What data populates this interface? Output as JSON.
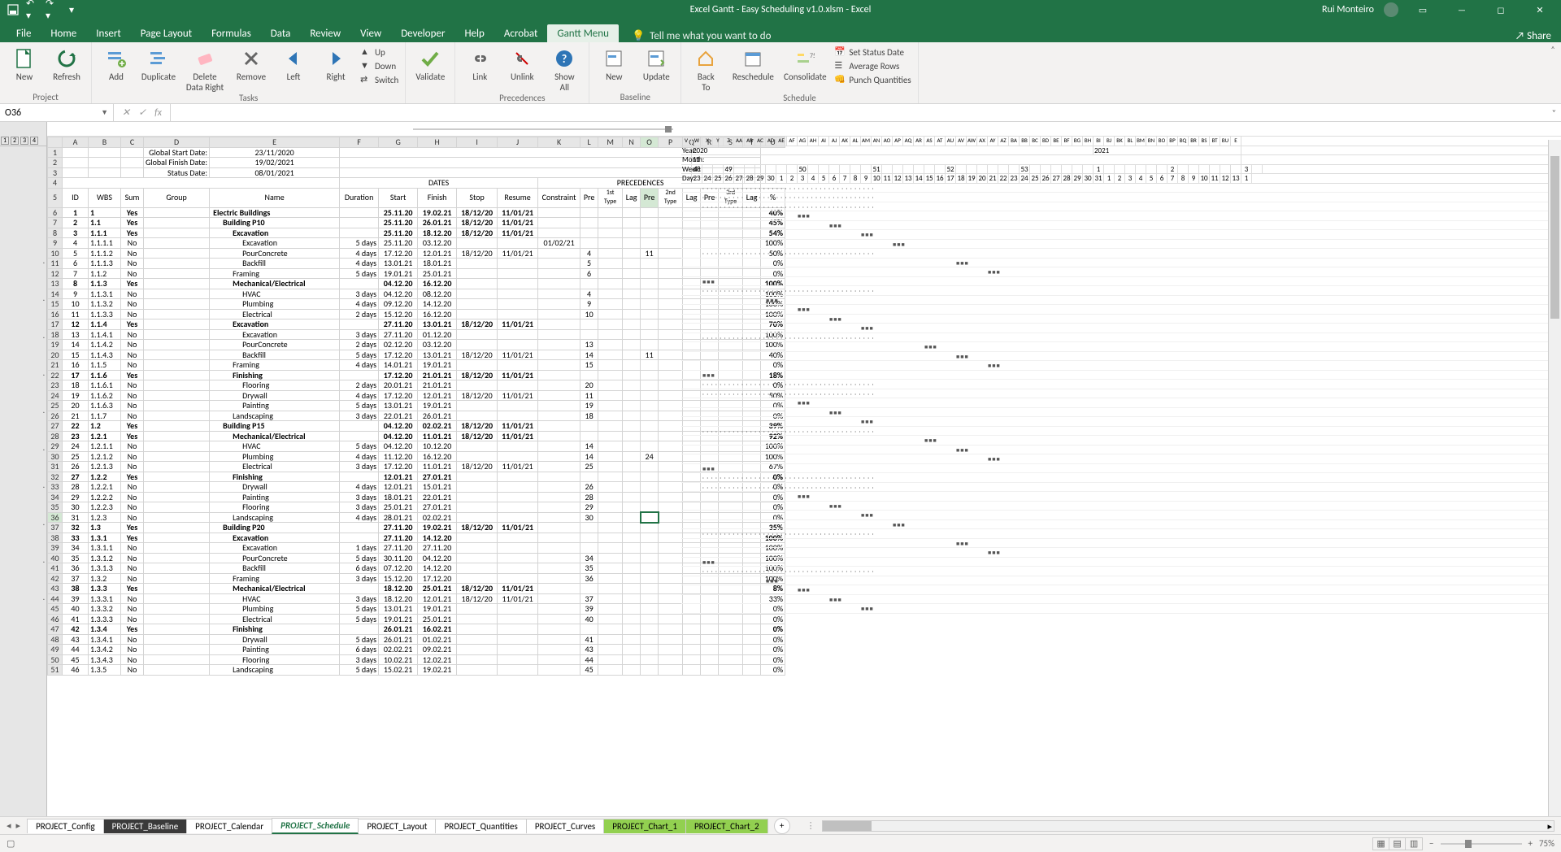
{
  "title": "Excel Gantt - Easy Scheduling v1.0.xlsm  -  Excel",
  "user": "Rui Monteiro",
  "tabs": [
    "File",
    "Home",
    "Insert",
    "Page Layout",
    "Formulas",
    "Data",
    "Review",
    "View",
    "Developer",
    "Help",
    "Acrobat",
    "Gantt Menu"
  ],
  "tell_me": "Tell me what you want to do",
  "share": "Share",
  "ribbon": {
    "groups": [
      {
        "label": "Project",
        "btns": [
          {
            "t": "New",
            "big": true,
            "icon": "doc"
          },
          {
            "t": "Refresh",
            "big": true,
            "icon": "refresh"
          }
        ]
      },
      {
        "label": "Tasks",
        "btns": [
          {
            "t": "Add",
            "big": true,
            "icon": "add"
          },
          {
            "t": "Duplicate",
            "big": true,
            "icon": "dup"
          },
          {
            "t": "Delete\nData Right",
            "big": true,
            "icon": "del"
          },
          {
            "t": "Remove",
            "big": true,
            "icon": "rem"
          },
          {
            "t": "Left",
            "big": true,
            "icon": "left"
          },
          {
            "t": "Right",
            "big": true,
            "icon": "right"
          }
        ],
        "small": [
          {
            "t": "Up",
            "icon": "up"
          },
          {
            "t": "Down",
            "icon": "down"
          },
          {
            "t": "Switch",
            "icon": "switch"
          }
        ]
      },
      {
        "label": "",
        "btns": [
          {
            "t": "Validate",
            "big": true,
            "icon": "check"
          }
        ]
      },
      {
        "label": "Precedences",
        "btns": [
          {
            "t": "Link",
            "big": true,
            "icon": "link"
          },
          {
            "t": "Unlink",
            "big": true,
            "icon": "unlink"
          },
          {
            "t": "Show\nAll",
            "big": true,
            "icon": "show"
          }
        ]
      },
      {
        "label": "Baseline",
        "btns": [
          {
            "t": "New",
            "big": true,
            "icon": "base"
          },
          {
            "t": "Update",
            "big": true,
            "icon": "upd"
          }
        ]
      },
      {
        "label": "Schedule",
        "btns": [
          {
            "t": "Back\nTo",
            "big": true,
            "icon": "back"
          },
          {
            "t": "Reschedule",
            "big": true,
            "icon": "resch"
          },
          {
            "t": "Consolidate",
            "big": true,
            "icon": "cons"
          }
        ],
        "small": [
          {
            "t": "Set Status Date",
            "icon": "cal"
          },
          {
            "t": "Average Rows",
            "icon": "avg"
          },
          {
            "t": "Punch Quantities",
            "icon": "punch"
          }
        ]
      }
    ]
  },
  "name_box": "O36",
  "meta": {
    "gs_label": "Global Start Date:",
    "gs": "23/11/2020",
    "ge_label": "Global Finish Date:",
    "ge": "19/02/2021",
    "sd_label": "Status Date:",
    "sd": "08/01/2021",
    "year_label": "Year:",
    "year": "2020",
    "year2": "2021",
    "month_label": "Month:",
    "month": "11",
    "week_label": "Week:",
    "week": "48",
    "day_label": "Day:",
    "week_nums": [
      "48",
      "",
      "",
      "49",
      "",
      "",
      "",
      "",
      "",
      "",
      "50",
      "",
      "",
      "",
      "",
      "",
      "",
      "51",
      "",
      "",
      "",
      "",
      "",
      "",
      "52",
      "",
      "",
      "",
      "",
      "",
      "",
      "53",
      "",
      "",
      "",
      "",
      "",
      "",
      "1",
      "",
      "",
      "",
      "",
      "",
      "",
      "2",
      "",
      "",
      "",
      "",
      "",
      "",
      "3",
      ""
    ],
    "day_nums": [
      "23",
      "24",
      "25",
      "26",
      "27",
      "28",
      "29",
      "30",
      "1",
      "2",
      "3",
      "4",
      "5",
      "6",
      "7",
      "8",
      "9",
      "10",
      "11",
      "12",
      "13",
      "14",
      "15",
      "16",
      "17",
      "18",
      "19",
      "20",
      "21",
      "22",
      "23",
      "24",
      "25",
      "26",
      "27",
      "28",
      "29",
      "30",
      "31",
      "1",
      "2",
      "3",
      "4",
      "5",
      "6",
      "7",
      "8",
      "9",
      "10",
      "11",
      "12",
      "13",
      "1"
    ]
  },
  "headers": {
    "dates": "DATES",
    "precedences": "PRECEDENCES",
    "pct": "%",
    "cols": [
      "ID",
      "WBS",
      "Sum",
      "Group",
      "Name",
      "Duration",
      "Start",
      "Finish",
      "Stop",
      "Resume",
      "Constraint",
      "Pre",
      "1st\nType",
      "Lag",
      "Pre",
      "2nd\nType",
      "Lag",
      "Pre",
      "3rd\nType",
      "Lag"
    ]
  },
  "rows": [
    {
      "r": 6,
      "id": "1",
      "wbs": "1",
      "sum": "Yes",
      "name": "Electric Buildings",
      "start": "25.11.20",
      "finish": "19.02.21",
      "stop": "18/12/20",
      "resume": "11/01/21",
      "pct": "40%",
      "b": true
    },
    {
      "r": 7,
      "id": "2",
      "wbs": "1.1",
      "sum": "Yes",
      "name": "Building P10",
      "start": "25.11.20",
      "finish": "26.01.21",
      "stop": "18/12/20",
      "resume": "11/01/21",
      "pct": "45%",
      "b": true
    },
    {
      "r": 8,
      "id": "3",
      "wbs": "1.1.1",
      "sum": "Yes",
      "name": "Excavation",
      "start": "25.11.20",
      "finish": "18.12.20",
      "stop": "18/12/20",
      "resume": "11/01/21",
      "pct": "54%",
      "b": true
    },
    {
      "r": 9,
      "id": "4",
      "wbs": "1.1.1.1",
      "sum": "No",
      "name": "Excavation",
      "dur": "5 days",
      "start": "25.11.20",
      "finish": "03.12.20",
      "con": "01/02/21",
      "pct": "100%"
    },
    {
      "r": 10,
      "id": "5",
      "wbs": "1.1.1.2",
      "sum": "No",
      "name": "PourConcrete",
      "dur": "4 days",
      "start": "17.12.20",
      "finish": "12.01.21",
      "stop": "18/12/20",
      "resume": "11/01/21",
      "p1": "4",
      "p2": "11",
      "pct": "50%"
    },
    {
      "r": 11,
      "id": "6",
      "wbs": "1.1.1.3",
      "sum": "No",
      "name": "Backfill",
      "dur": "4 days",
      "start": "13.01.21",
      "finish": "18.01.21",
      "p1": "5",
      "pct": "0%"
    },
    {
      "r": 12,
      "id": "7",
      "wbs": "1.1.2",
      "sum": "No",
      "name": "Framing",
      "dur": "5 days",
      "start": "19.01.21",
      "finish": "25.01.21",
      "p1": "6",
      "pct": "0%"
    },
    {
      "r": 13,
      "id": "8",
      "wbs": "1.1.3",
      "sum": "Yes",
      "name": "Mechanical/Electrical",
      "start": "04.12.20",
      "finish": "16.12.20",
      "pct": "100%",
      "b": true
    },
    {
      "r": 14,
      "id": "9",
      "wbs": "1.1.3.1",
      "sum": "No",
      "name": "HVAC",
      "dur": "3 days",
      "start": "04.12.20",
      "finish": "08.12.20",
      "p1": "4",
      "pct": "100%"
    },
    {
      "r": 15,
      "id": "10",
      "wbs": "1.1.3.2",
      "sum": "No",
      "name": "Plumbing",
      "dur": "4 days",
      "start": "09.12.20",
      "finish": "14.12.20",
      "p1": "9",
      "pct": "100%"
    },
    {
      "r": 16,
      "id": "11",
      "wbs": "1.1.3.3",
      "sum": "No",
      "name": "Electrical",
      "dur": "2 days",
      "start": "15.12.20",
      "finish": "16.12.20",
      "p1": "10",
      "pct": "100%"
    },
    {
      "r": 17,
      "id": "12",
      "wbs": "1.1.4",
      "sum": "Yes",
      "name": "Excavation",
      "start": "27.11.20",
      "finish": "13.01.21",
      "stop": "18/12/20",
      "resume": "11/01/21",
      "pct": "70%",
      "b": true
    },
    {
      "r": 18,
      "id": "13",
      "wbs": "1.1.4.1",
      "sum": "No",
      "name": "Excavation",
      "dur": "3 days",
      "start": "27.11.20",
      "finish": "01.12.20",
      "pct": "100%"
    },
    {
      "r": 19,
      "id": "14",
      "wbs": "1.1.4.2",
      "sum": "No",
      "name": "PourConcrete",
      "dur": "2 days",
      "start": "02.12.20",
      "finish": "03.12.20",
      "p1": "13",
      "pct": "100%"
    },
    {
      "r": 20,
      "id": "15",
      "wbs": "1.1.4.3",
      "sum": "No",
      "name": "Backfill",
      "dur": "5 days",
      "start": "17.12.20",
      "finish": "13.01.21",
      "stop": "18/12/20",
      "resume": "11/01/21",
      "p1": "14",
      "p2": "11",
      "pct": "40%"
    },
    {
      "r": 21,
      "id": "16",
      "wbs": "1.1.5",
      "sum": "No",
      "name": "Framing",
      "dur": "4 days",
      "start": "14.01.21",
      "finish": "19.01.21",
      "p1": "15",
      "pct": "0%"
    },
    {
      "r": 22,
      "id": "17",
      "wbs": "1.1.6",
      "sum": "Yes",
      "name": "Finishing",
      "start": "17.12.20",
      "finish": "21.01.21",
      "stop": "18/12/20",
      "resume": "11/01/21",
      "pct": "18%",
      "b": true
    },
    {
      "r": 23,
      "id": "18",
      "wbs": "1.1.6.1",
      "sum": "No",
      "name": "Flooring",
      "dur": "2 days",
      "start": "20.01.21",
      "finish": "21.01.21",
      "p1": "20",
      "pct": "0%"
    },
    {
      "r": 24,
      "id": "19",
      "wbs": "1.1.6.2",
      "sum": "No",
      "name": "Drywall",
      "dur": "4 days",
      "start": "17.12.20",
      "finish": "12.01.21",
      "stop": "18/12/20",
      "resume": "11/01/21",
      "p1": "11",
      "pct": "50%"
    },
    {
      "r": 25,
      "id": "20",
      "wbs": "1.1.6.3",
      "sum": "No",
      "name": "Painting",
      "dur": "5 days",
      "start": "13.01.21",
      "finish": "19.01.21",
      "p1": "19",
      "pct": "0%"
    },
    {
      "r": 26,
      "id": "21",
      "wbs": "1.1.7",
      "sum": "No",
      "name": "Landscaping",
      "dur": "3 days",
      "start": "22.01.21",
      "finish": "26.01.21",
      "p1": "18",
      "pct": "0%"
    },
    {
      "r": 27,
      "id": "22",
      "wbs": "1.2",
      "sum": "Yes",
      "name": "Building P15",
      "start": "04.12.20",
      "finish": "02.02.21",
      "stop": "18/12/20",
      "resume": "11/01/21",
      "pct": "39%",
      "b": true
    },
    {
      "r": 28,
      "id": "23",
      "wbs": "1.2.1",
      "sum": "Yes",
      "name": "Mechanical/Electrical",
      "start": "04.12.20",
      "finish": "11.01.21",
      "stop": "18/12/20",
      "resume": "11/01/21",
      "pct": "92%",
      "b": true
    },
    {
      "r": 29,
      "id": "24",
      "wbs": "1.2.1.1",
      "sum": "No",
      "name": "HVAC",
      "dur": "5 days",
      "start": "04.12.20",
      "finish": "10.12.20",
      "p1": "14",
      "pct": "100%"
    },
    {
      "r": 30,
      "id": "25",
      "wbs": "1.2.1.2",
      "sum": "No",
      "name": "Plumbing",
      "dur": "4 days",
      "start": "11.12.20",
      "finish": "16.12.20",
      "p1": "14",
      "p2": "24",
      "pct": "100%"
    },
    {
      "r": 31,
      "id": "26",
      "wbs": "1.2.1.3",
      "sum": "No",
      "name": "Electrical",
      "dur": "3 days",
      "start": "17.12.20",
      "finish": "11.01.21",
      "stop": "18/12/20",
      "resume": "11/01/21",
      "p1": "25",
      "pct": "67%"
    },
    {
      "r": 32,
      "id": "27",
      "wbs": "1.2.2",
      "sum": "Yes",
      "name": "Finishing",
      "start": "12.01.21",
      "finish": "27.01.21",
      "pct": "0%",
      "b": true
    },
    {
      "r": 33,
      "id": "28",
      "wbs": "1.2.2.1",
      "sum": "No",
      "name": "Drywall",
      "dur": "4 days",
      "start": "12.01.21",
      "finish": "15.01.21",
      "p1": "26",
      "pct": "0%"
    },
    {
      "r": 34,
      "id": "29",
      "wbs": "1.2.2.2",
      "sum": "No",
      "name": "Painting",
      "dur": "3 days",
      "start": "18.01.21",
      "finish": "22.01.21",
      "p1": "28",
      "pct": "0%"
    },
    {
      "r": 35,
      "id": "30",
      "wbs": "1.2.2.3",
      "sum": "No",
      "name": "Flooring",
      "dur": "3 days",
      "start": "25.01.21",
      "finish": "27.01.21",
      "p1": "29",
      "pct": "0%"
    },
    {
      "r": 36,
      "id": "31",
      "wbs": "1.2.3",
      "sum": "No",
      "name": "Landscaping",
      "dur": "4 days",
      "start": "28.01.21",
      "finish": "02.02.21",
      "p1": "30",
      "pct": "0%"
    },
    {
      "r": 37,
      "id": "32",
      "wbs": "1.3",
      "sum": "Yes",
      "name": "Building P20",
      "start": "27.11.20",
      "finish": "19.02.21",
      "stop": "18/12/20",
      "resume": "11/01/21",
      "pct": "35%",
      "b": true
    },
    {
      "r": 38,
      "id": "33",
      "wbs": "1.3.1",
      "sum": "Yes",
      "name": "Excavation",
      "start": "27.11.20",
      "finish": "14.12.20",
      "pct": "100%",
      "b": true
    },
    {
      "r": 39,
      "id": "34",
      "wbs": "1.3.1.1",
      "sum": "No",
      "name": "Excavation",
      "dur": "1 days",
      "start": "27.11.20",
      "finish": "27.11.20",
      "pct": "100%"
    },
    {
      "r": 40,
      "id": "35",
      "wbs": "1.3.1.2",
      "sum": "No",
      "name": "PourConcrete",
      "dur": "5 days",
      "start": "30.11.20",
      "finish": "04.12.20",
      "p1": "34",
      "pct": "100%"
    },
    {
      "r": 41,
      "id": "36",
      "wbs": "1.3.1.3",
      "sum": "No",
      "name": "Backfill",
      "dur": "6 days",
      "start": "07.12.20",
      "finish": "14.12.20",
      "p1": "35",
      "pct": "100%"
    },
    {
      "r": 42,
      "id": "37",
      "wbs": "1.3.2",
      "sum": "No",
      "name": "Framing",
      "dur": "3 days",
      "start": "15.12.20",
      "finish": "17.12.20",
      "p1": "36",
      "pct": "100%"
    },
    {
      "r": 43,
      "id": "38",
      "wbs": "1.3.3",
      "sum": "Yes",
      "name": "Mechanical/Electrical",
      "start": "18.12.20",
      "finish": "25.01.21",
      "stop": "18/12/20",
      "resume": "11/01/21",
      "pct": "8%",
      "b": true
    },
    {
      "r": 44,
      "id": "39",
      "wbs": "1.3.3.1",
      "sum": "No",
      "name": "HVAC",
      "dur": "3 days",
      "start": "18.12.20",
      "finish": "12.01.21",
      "stop": "18/12/20",
      "resume": "11/01/21",
      "p1": "37",
      "pct": "33%"
    },
    {
      "r": 45,
      "id": "40",
      "wbs": "1.3.3.2",
      "sum": "No",
      "name": "Plumbing",
      "dur": "5 days",
      "start": "13.01.21",
      "finish": "19.01.21",
      "p1": "39",
      "pct": "0%"
    },
    {
      "r": 46,
      "id": "41",
      "wbs": "1.3.3.3",
      "sum": "No",
      "name": "Electrical",
      "dur": "5 days",
      "start": "19.01.21",
      "finish": "25.01.21",
      "p1": "40",
      "pct": "0%"
    },
    {
      "r": 47,
      "id": "42",
      "wbs": "1.3.4",
      "sum": "Yes",
      "name": "Finishing",
      "start": "26.01.21",
      "finish": "16.02.21",
      "pct": "0%",
      "b": true
    },
    {
      "r": 48,
      "id": "43",
      "wbs": "1.3.4.1",
      "sum": "No",
      "name": "Drywall",
      "dur": "5 days",
      "start": "26.01.21",
      "finish": "01.02.21",
      "p1": "41",
      "pct": "0%"
    },
    {
      "r": 49,
      "id": "44",
      "wbs": "1.3.4.2",
      "sum": "No",
      "name": "Painting",
      "dur": "6 days",
      "start": "02.02.21",
      "finish": "09.02.21",
      "p1": "43",
      "pct": "0%"
    },
    {
      "r": 50,
      "id": "45",
      "wbs": "1.3.4.3",
      "sum": "No",
      "name": "Flooring",
      "dur": "3 days",
      "start": "10.02.21",
      "finish": "12.02.21",
      "p1": "44",
      "pct": "0%"
    },
    {
      "r": 51,
      "id": "46",
      "wbs": "1.3.5",
      "sum": "No",
      "name": "Landscaping",
      "dur": "5 days",
      "start": "15.02.21",
      "finish": "19.02.21",
      "p1": "45",
      "pct": "0%"
    }
  ],
  "col_letters": [
    "A",
    "B",
    "C",
    "D",
    "E",
    "F",
    "G",
    "H",
    "I",
    "J",
    "K",
    "L",
    "M",
    "N",
    "O",
    "P",
    "Q",
    "R",
    "S",
    "T",
    "U"
  ],
  "gantt_cols": [
    "V",
    "W",
    "X",
    "Y",
    "Z",
    "AA",
    "AB",
    "AC",
    "AD",
    "AE",
    "AF",
    "AG",
    "AH",
    "AI",
    "AJ",
    "AK",
    "AL",
    "AM",
    "AN",
    "AO",
    "AP",
    "AQ",
    "AR",
    "AS",
    "AT",
    "AU",
    "AV",
    "AW",
    "AX",
    "AY",
    "AZ",
    "BA",
    "BB",
    "BC",
    "BD",
    "BE",
    "BF",
    "BG",
    "BH",
    "BI",
    "BJ",
    "BK",
    "BL",
    "BM",
    "BN",
    "BO",
    "BP",
    "BQ",
    "BR",
    "BS",
    "BT",
    "BU",
    "E"
  ],
  "sheet_tabs": [
    "PROJECT_Config",
    "PROJECT_Baseline",
    "PROJECT_Calendar",
    "PROJECT_Schedule",
    "PROJECT_Layout",
    "PROJECT_Quantities",
    "PROJECT_Curves",
    "PROJECT_Chart_1",
    "PROJECT_Chart_2"
  ],
  "zoom": "75%",
  "row_nums": [
    1,
    2,
    3,
    4,
    5,
    6,
    7,
    8,
    9,
    10,
    11,
    12,
    13,
    14,
    15,
    16,
    17,
    18,
    19,
    20,
    21,
    22,
    23,
    24,
    25,
    26,
    27,
    28,
    29,
    30,
    31,
    32,
    33,
    34,
    35,
    36,
    37,
    38,
    39,
    40,
    41,
    42,
    43,
    44,
    45,
    46,
    47,
    48,
    49,
    50,
    51
  ]
}
